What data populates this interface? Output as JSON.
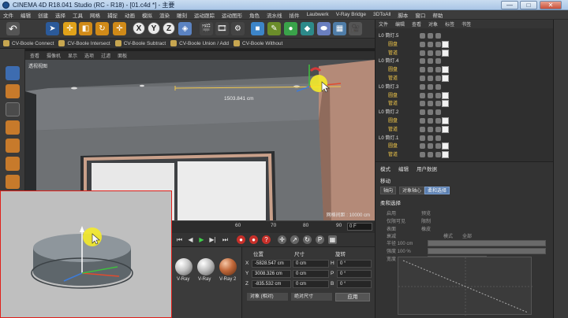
{
  "window": {
    "title": "CINEMA 4D R18.041 Studio (RC - R18) - [01.c4d *] - 主要",
    "min": "—",
    "max": "□",
    "close": "✕"
  },
  "menu": [
    "文件",
    "编辑",
    "创建",
    "选择",
    "工具",
    "网格",
    "捕捉",
    "动画",
    "模拟",
    "渲染",
    "雕刻",
    "运动跟踪",
    "运动图形",
    "角色",
    "流水线",
    "插件",
    "Laubwerk",
    "V-Ray Bridge",
    "3DToAll",
    "脚本",
    "窗口",
    "帮助"
  ],
  "toolbar": {
    "axes": [
      "X",
      "Y",
      "Z"
    ]
  },
  "plugins": [
    "CV-Boole Connect",
    "CV-Boole Intersect",
    "CV-Boole Subtract",
    "CV-Boole Union / Add",
    "CV-Boole Without"
  ],
  "viewport": {
    "menu": [
      "查看",
      "摄像机",
      "显示",
      "选项",
      "过滤",
      "面板"
    ],
    "label": "透视视图",
    "measure": "1503.841 cm",
    "grid": "网格间距 : 10000 cm"
  },
  "timeline": {
    "ticks": [
      "60",
      "70",
      "80",
      "90"
    ],
    "frame": "0 F"
  },
  "materials": [
    {
      "label": "V-Ray",
      "color": "#c4c4c4"
    },
    {
      "label": "V-Ray",
      "color": "#bebebe"
    },
    {
      "label": "V-Ray 2",
      "color": "#c0683a"
    }
  ],
  "coords": {
    "headers": [
      "位置",
      "尺寸",
      "旋转"
    ],
    "rows": [
      {
        "axis": "X",
        "pos": "-5828.547 cm",
        "size": "0 cm",
        "rot_axis": "H",
        "rot": "0 °"
      },
      {
        "axis": "Y",
        "pos": "3008.326 cm",
        "size": "0 cm",
        "rot_axis": "P",
        "rot": "0 °"
      },
      {
        "axis": "Z",
        "pos": "-835.532 cm",
        "size": "0 cm",
        "rot_axis": "B",
        "rot": "0 °"
      }
    ],
    "mode": "对象 (相对)",
    "size_mode": "绝对尺寸",
    "apply": "应用"
  },
  "object_manager": {
    "menu": [
      "文件",
      "编辑",
      "查看",
      "对象",
      "标签",
      "书签"
    ],
    "rows": [
      {
        "label": "L0 筒灯.5",
        "indent": 0
      },
      {
        "label": "圆盘",
        "indent": 1
      },
      {
        "label": "管道",
        "indent": 1
      },
      {
        "label": "L0 筒灯.4",
        "indent": 0
      },
      {
        "label": "圆盘",
        "indent": 1
      },
      {
        "label": "管道",
        "indent": 1
      },
      {
        "label": "L0 筒灯.3",
        "indent": 0
      },
      {
        "label": "圆盘",
        "indent": 1
      },
      {
        "label": "管道",
        "indent": 1
      },
      {
        "label": "L0 筒灯.2",
        "indent": 0
      },
      {
        "label": "圆盘",
        "indent": 1
      },
      {
        "label": "管道",
        "indent": 1
      },
      {
        "label": "L0 筒灯.1",
        "indent": 0
      },
      {
        "label": "圆盘",
        "indent": 1
      },
      {
        "label": "管道",
        "indent": 1
      }
    ]
  },
  "attributes": {
    "menu": [
      "模式",
      "编辑",
      "用户数据"
    ],
    "title": "移动",
    "tabs": [
      "轴向",
      "对象轴心",
      "柔和选择"
    ],
    "active_tab": 2,
    "section": "柔和选择",
    "labels": [
      "启用",
      "预览",
      "仅限可见",
      "限制",
      "表面",
      "橡皮",
      "模式",
      "全部",
      "衰减",
      "半径 100 cm",
      "强度 100 %",
      "宽度 50 %"
    ]
  }
}
